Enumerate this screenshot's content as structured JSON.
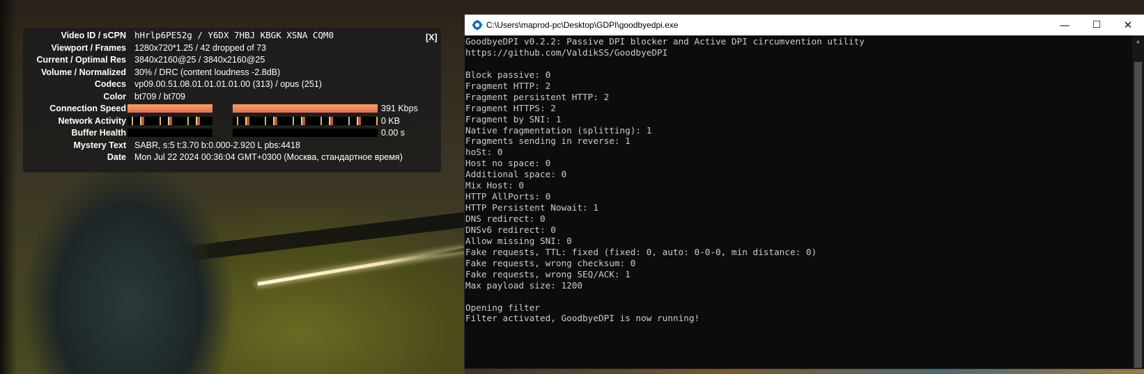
{
  "stats": {
    "close_label": "[X]",
    "rows": [
      {
        "label": "Video ID / sCPN",
        "value": "hHrlp6PE52g / Y6DX 7HBJ KBGK XSNA CQM0"
      },
      {
        "label": "Viewport / Frames",
        "value": "1280x720*1.25 / 42 dropped of 73"
      },
      {
        "label": "Current / Optimal Res",
        "value": "3840x2160@25 / 3840x2160@25"
      },
      {
        "label": "Volume / Normalized",
        "value": "30% / DRC (content loudness -2.8dB)"
      },
      {
        "label": "Codecs",
        "value": "vp09.00.51.08.01.01.01.01.00 (313) / opus (251)"
      },
      {
        "label": "Color",
        "value": "bt709 / bt709"
      }
    ],
    "connection_speed": {
      "label": "Connection Speed",
      "value": "391 Kbps"
    },
    "network_activity": {
      "label": "Network Activity",
      "value": "0 KB"
    },
    "buffer_health": {
      "label": "Buffer Health",
      "value": "0.00 s"
    },
    "mystery_text": {
      "label": "Mystery Text",
      "value": "SABR, s:5 t:3.70 b:0.000-2.920 L pbs:4418"
    },
    "date": {
      "label": "Date",
      "value": "Mon Jul 22 2024 00:36:04 GMT+0300 (Москва, стандартное время)"
    }
  },
  "console": {
    "title": "C:\\Users\\maprod-pc\\Desktop\\GDPI\\goodbyedpi.exe",
    "controls": {
      "minimize": "—",
      "maximize": "☐",
      "close": "✕"
    },
    "lines": [
      "GoodbyeDPI v0.2.2: Passive DPI blocker and Active DPI circumvention utility",
      "https://github.com/ValdikSS/GoodbyeDPI",
      "",
      "Block passive: 0",
      "Fragment HTTP: 2",
      "Fragment persistent HTTP: 2",
      "Fragment HTTPS: 2",
      "Fragment by SNI: 1",
      "Native fragmentation (splitting): 1",
      "Fragments sending in reverse: 1",
      "hoSt: 0",
      "Host no space: 0",
      "Additional space: 0",
      "Mix Host: 0",
      "HTTP AllPorts: 0",
      "HTTP Persistent Nowait: 1",
      "DNS redirect: 0",
      "DNSv6 redirect: 0",
      "Allow missing SNI: 0",
      "Fake requests, TTL: fixed (fixed: 0, auto: 0-0-0, min distance: 0)",
      "Fake requests, wrong checksum: 0",
      "Fake requests, wrong SEQ/ACK: 1",
      "Max payload size: 1200",
      "",
      "Opening filter",
      "Filter activated, GoodbyeDPI is now running!"
    ]
  },
  "colors": {
    "console_bg": "#0c0c0c",
    "console_text": "#cccccc",
    "stats_bar": "#e8704a"
  }
}
